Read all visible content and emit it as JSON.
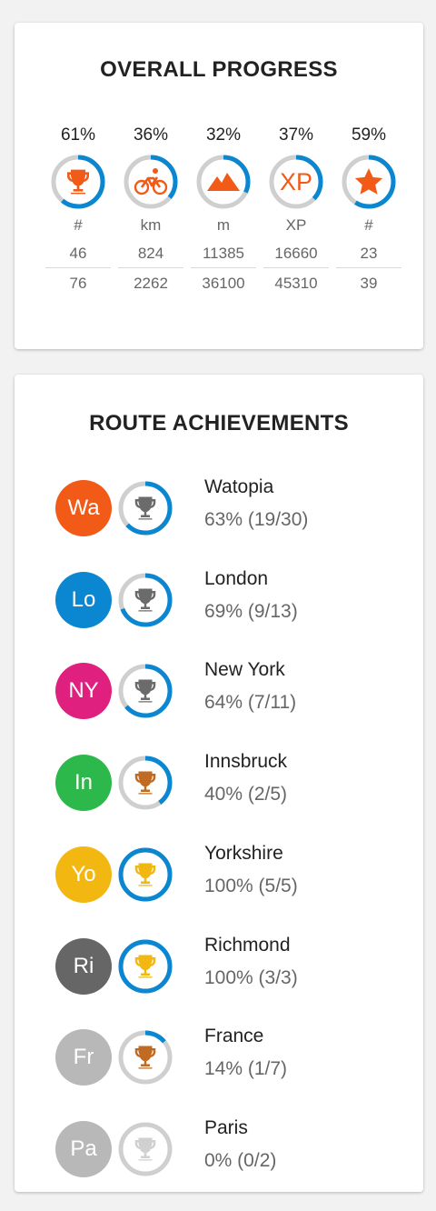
{
  "overall": {
    "title": "OVERALL PROGRESS",
    "stats": [
      {
        "percent_label": "61%",
        "fraction": 0.61,
        "icon": "trophy-icon",
        "unit": "#",
        "current": "46",
        "total": "76"
      },
      {
        "percent_label": "36%",
        "fraction": 0.36,
        "icon": "bicycle-icon",
        "unit": "km",
        "current": "824",
        "total": "2262"
      },
      {
        "percent_label": "32%",
        "fraction": 0.32,
        "icon": "mountain-icon",
        "unit": "m",
        "current": "11385",
        "total": "36100"
      },
      {
        "percent_label": "37%",
        "fraction": 0.37,
        "icon": "xp-icon",
        "icon_text": "XP",
        "unit": "XP",
        "current": "16660",
        "total": "45310"
      },
      {
        "percent_label": "59%",
        "fraction": 0.59,
        "icon": "star-icon",
        "unit": "#",
        "current": "23",
        "total": "39"
      }
    ]
  },
  "routes": {
    "title": "ROUTE ACHIEVEMENTS",
    "items": [
      {
        "abbr": "Wa",
        "name": "Watopia",
        "progress": "63% (19/30)",
        "fraction": 0.63,
        "badge_color": "#f25a17",
        "trophy_color": "#6b6b6b"
      },
      {
        "abbr": "Lo",
        "name": "London",
        "progress": "69% (9/13)",
        "fraction": 0.69,
        "badge_color": "#0b86d1",
        "trophy_color": "#6b6b6b"
      },
      {
        "abbr": "NY",
        "name": "New York",
        "progress": "64% (7/11)",
        "fraction": 0.64,
        "badge_color": "#e0207e",
        "trophy_color": "#6b6b6b"
      },
      {
        "abbr": "In",
        "name": "Innsbruck",
        "progress": "40% (2/5)",
        "fraction": 0.4,
        "badge_color": "#2db84b",
        "trophy_color": "#c06a22"
      },
      {
        "abbr": "Yo",
        "name": "Yorkshire",
        "progress": "100% (5/5)",
        "fraction": 1.0,
        "badge_color": "#f2b711",
        "trophy_color": "#f2b711"
      },
      {
        "abbr": "Ri",
        "name": "Richmond",
        "progress": "100% (3/3)",
        "fraction": 1.0,
        "badge_color": "#666666",
        "trophy_color": "#f2b711"
      },
      {
        "abbr": "Fr",
        "name": "France",
        "progress": "14% (1/7)",
        "fraction": 0.14,
        "badge_color": "#b8b8b8",
        "trophy_color": "#c06a22"
      },
      {
        "abbr": "Pa",
        "name": "Paris",
        "progress": "0% (0/2)",
        "fraction": 0.0,
        "badge_color": "#b8b8b8",
        "trophy_color": "#d0d0d0"
      }
    ]
  },
  "colors": {
    "ring_track": "#cfcfcf",
    "ring_fill": "#0b86d1",
    "icon_orange": "#f25a17"
  }
}
